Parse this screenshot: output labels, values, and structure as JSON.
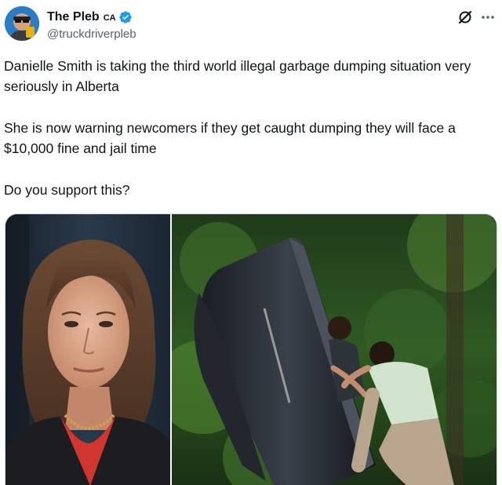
{
  "author": {
    "display_name": "The Pleb",
    "country_tag": "CA",
    "handle": "@truckdriverpleb",
    "verified": true,
    "avatar_icon": "avatar-icon"
  },
  "header_actions": {
    "grok_icon": "grok-icon",
    "more_icon": "more-options-icon"
  },
  "tweet": {
    "paragraphs": [
      "Danielle Smith is taking the third world illegal garbage dumping situation very seriously in Alberta",
      "She is now warning newcomers if they get caught dumping they will face a $10,000 fine and jail time",
      "Do you support this?"
    ]
  },
  "media": {
    "images": [
      {
        "subject": "portrait-photo"
      },
      {
        "subject": "forest-dumping-photo"
      }
    ]
  },
  "colors": {
    "text": "#0f1419",
    "secondary_text": "#536471",
    "verified_blue": "#1d9bf0",
    "border": "#cfd9de"
  }
}
